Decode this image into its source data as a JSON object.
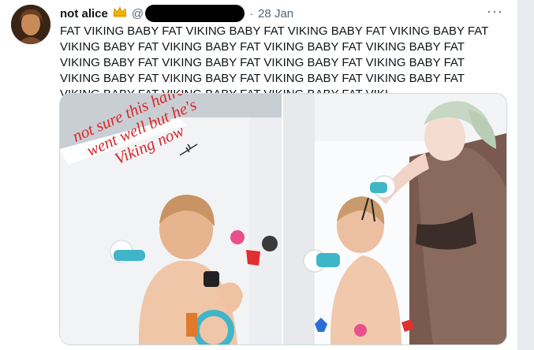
{
  "tweet": {
    "display_name": "not alice",
    "crown_icon": "crown-emoji",
    "handle_prefix": "@",
    "dot": "·",
    "date": "28 Jan",
    "more_icon": "···",
    "text": "FAT VIKING BABY FAT VIKING BABY FAT VIKING BABY FAT VIKING BABY FAT VIKING BABY FAT VIKING BABY FAT VIKING BABY FAT VIKING BABY FAT VIKING BABY FAT VIKING BABY FAT VIKING BABY FAT VIKING BABY FAT VIKING BABY FAT VIKING BABY FAT VIKING BABY FAT VIKING BABY FAT VIKING BABY FAT VIKING BABY FAT VIKING BABY FAT VIKI"
  },
  "media": {
    "left_photo_overlay": [
      "not sure this haircut",
      "went well but he's",
      "Viking now"
    ]
  },
  "colors": {
    "overlay_text": "#d62a2a",
    "secondary_text": "#536471"
  }
}
